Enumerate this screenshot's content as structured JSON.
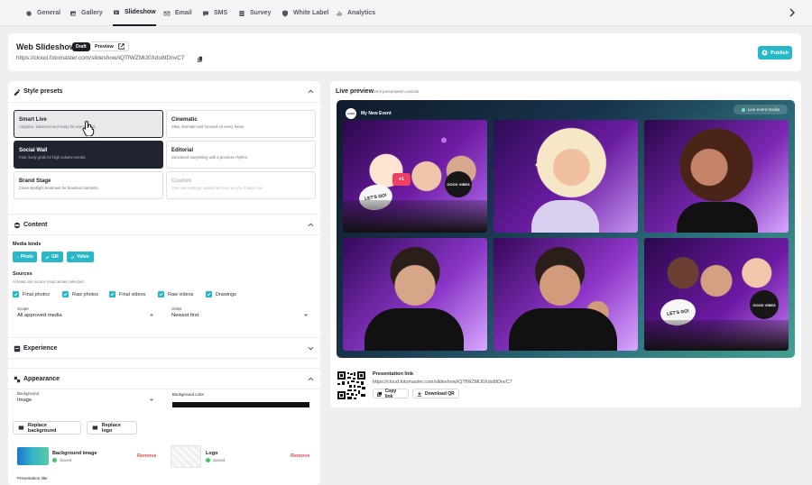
{
  "nav": {
    "items": [
      {
        "label": "General",
        "icon": "gear-icon"
      },
      {
        "label": "Gallery",
        "icon": "gallery-icon"
      },
      {
        "label": "Slideshow",
        "icon": "slideshow-icon",
        "active": true
      },
      {
        "label": "Email",
        "icon": "email-icon"
      },
      {
        "label": "SMS",
        "icon": "sms-icon"
      },
      {
        "label": "Survey",
        "icon": "survey-icon"
      },
      {
        "label": "White Label",
        "icon": "shield-icon"
      },
      {
        "label": "Analytics",
        "icon": "analytics-icon"
      }
    ],
    "next_icon": "chevron-right-icon"
  },
  "header": {
    "title": "Web Slideshow",
    "status": "Draft",
    "preview_label": "Preview",
    "url": "https://cloud.fotomaster.com/slideshow/iQTfWZMlJ0Xdo8tDnvC7",
    "publish_label": "Publish"
  },
  "style": {
    "title": "Style presets",
    "presets": [
      {
        "name": "Smart Live",
        "desc": "Adaptive, balanced and ready for every event."
      },
      {
        "name": "Cinematic",
        "desc": "Slow, dramatic and focused on every frame."
      },
      {
        "name": "Social Wall",
        "desc": "Fast, lively grids for high volume events."
      },
      {
        "name": "Editorial",
        "desc": "Structured storytelling with a premium rhythm."
      },
      {
        "name": "Brand Stage",
        "desc": "Clean spotlight treatment for branded moments."
      },
      {
        "name": "Custom",
        "desc": "Your own settings, applied as soon as you change one."
      }
    ]
  },
  "content": {
    "title": "Content",
    "media_kinds_label": "Media kinds",
    "media_kinds": [
      "Photo",
      "GIF",
      "Video"
    ],
    "sources_label": "Sources",
    "sources_hint": "At least one source must remain selected",
    "sources": [
      "Final photos",
      "Raw photos",
      "Final videos",
      "Raw videos",
      "Drawings"
    ],
    "scope": {
      "label": "Scope",
      "value": "All approved media"
    },
    "order": {
      "label": "Order",
      "value": "Newest first"
    }
  },
  "experience": {
    "title": "Experience"
  },
  "appearance": {
    "title": "Appearance",
    "background": {
      "label": "Background",
      "value": "Image"
    },
    "background_color_label": "Background color",
    "replace_background": "Replace background",
    "replace_logo": "Replace logo",
    "background_image_label": "Background image",
    "logo_label": "Logo",
    "saved": "Saved",
    "remove": "Remove",
    "presentation_title_label": "Presentation title"
  },
  "preview": {
    "title": "Live preview",
    "subtitle": "16:9 presentation canvas",
    "event_name": "My New Event",
    "event_badge": "LOGO",
    "live_event_label": "Live event media",
    "tile_text": {
      "lets": "LET'S GO!",
      "good": "GOOD VIBES",
      "heart": "1"
    },
    "presentation_link_label": "Presentation link",
    "presentation_url": "https://cloud.fotomaster.com/slideshow/iQTfWZMlJ0Xdo8tDnvC7",
    "copy_link": "Copy link",
    "download_qr": "Download QR"
  },
  "colors": {
    "accent": "#28b8c9",
    "selected": "#1f2430",
    "remove": "#e14d4d",
    "saved": "#46c267"
  }
}
